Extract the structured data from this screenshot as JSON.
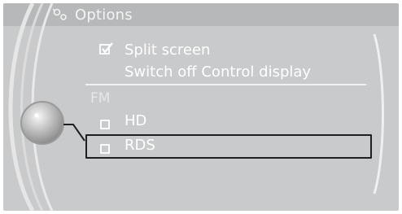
{
  "header": {
    "icon": "options-icon",
    "title": "Options"
  },
  "menu": {
    "items": [
      {
        "label": "Split screen",
        "checked": true,
        "selected": false
      },
      {
        "label": "Switch off Control display",
        "selected": false
      }
    ],
    "section": {
      "label": "FM",
      "items": [
        {
          "label": "HD",
          "checked": false,
          "selected": false
        },
        {
          "label": "RDS",
          "checked": false,
          "selected": true
        }
      ]
    }
  },
  "colors": {
    "screen_bg": "#c9cacb",
    "text": "#ffffff",
    "selection_border": "#1f1f1f"
  }
}
